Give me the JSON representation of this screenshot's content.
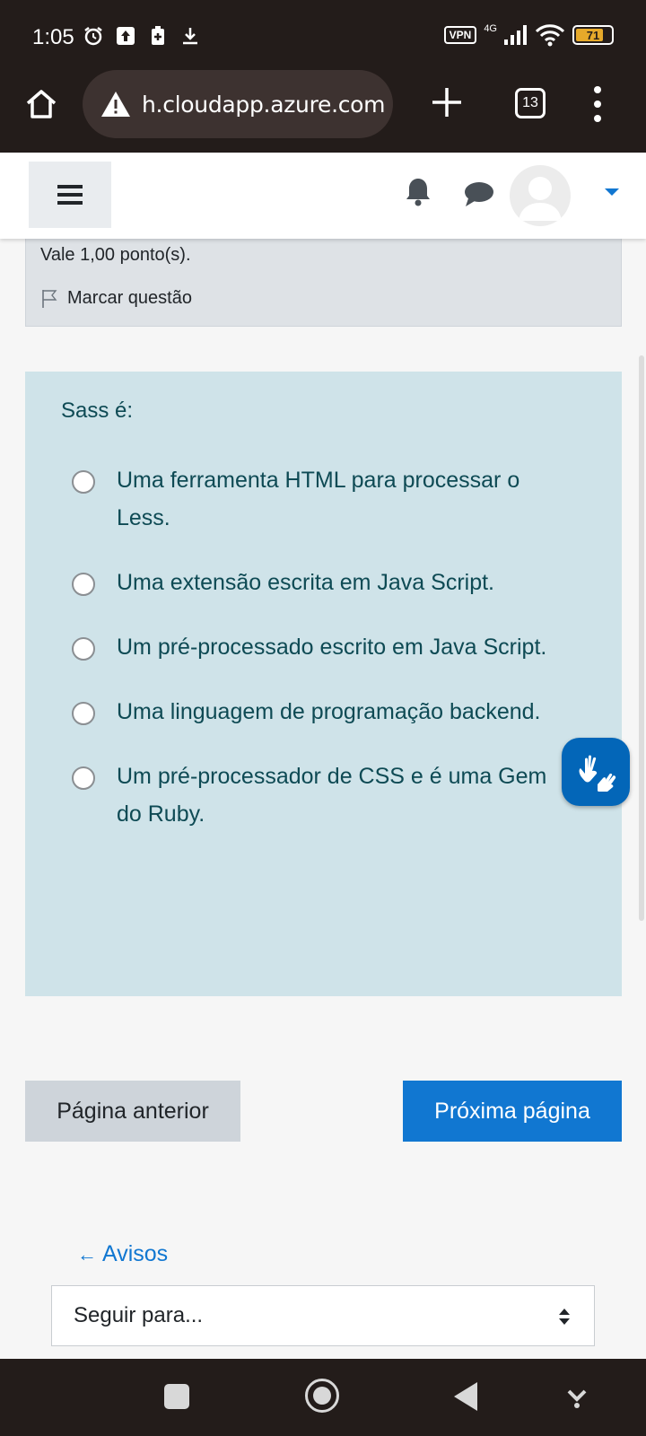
{
  "status_bar": {
    "time": "1:05",
    "network": "4G",
    "vpn_label": "VPN",
    "battery_level": "71"
  },
  "browser": {
    "url": "h.cloudapp.azure.com",
    "tab_count": "13"
  },
  "question_info": {
    "points": "Vale 1,00 ponto(s).",
    "flag_label": "Marcar questão"
  },
  "question": {
    "text": "Sass é:",
    "answers": [
      {
        "label": "Uma ferramenta HTML para processar o Less.",
        "selected": false
      },
      {
        "label": "Uma extensão escrita em Java Script.",
        "selected": false
      },
      {
        "label": "Um pré-processado escrito em Java Script.",
        "selected": false
      },
      {
        "label": "Uma linguagem de programação backend.",
        "selected": false
      },
      {
        "label": "Um pré-processador de CSS e é uma Gem do Ruby.",
        "selected": false
      }
    ]
  },
  "pager": {
    "prev_label": "Página anterior",
    "next_label": "Próxima página"
  },
  "activity_nav": {
    "prev_link_arrow": "←",
    "prev_link": "Avisos",
    "jump_placeholder": "Seguir para..."
  },
  "colors": {
    "primary": "#1177d1",
    "question_bg": "#cfe3e9",
    "question_text": "#0e4a54",
    "info_bg": "#dee2e6",
    "system_bar": "#231c1a"
  }
}
